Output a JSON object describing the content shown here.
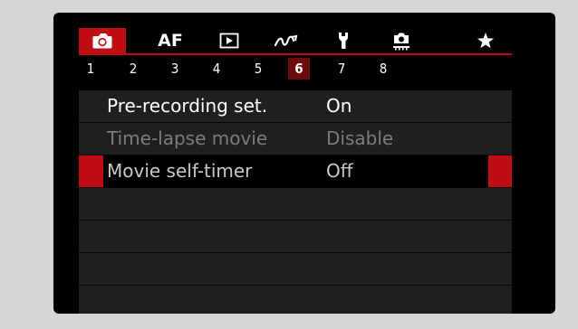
{
  "tabs": [
    {
      "icon": "camera-icon",
      "active": true
    },
    {
      "label": "AF"
    },
    {
      "icon": "playback-icon"
    },
    {
      "icon": "wireless-icon"
    },
    {
      "icon": "wrench-icon"
    },
    {
      "icon": "custom-functions-icon"
    },
    {
      "icon": "star-icon"
    }
  ],
  "tab_af_label": "AF",
  "subtabs": [
    "1",
    "2",
    "3",
    "4",
    "5",
    "6",
    "7",
    "8"
  ],
  "active_subtab": "6",
  "menu": [
    {
      "label": "Pre-recording set.",
      "value": "On",
      "state": "enabled"
    },
    {
      "label": "Time-lapse movie",
      "value": "Disable",
      "state": "disabled"
    },
    {
      "label": "Movie self-timer",
      "value": "Off",
      "state": "selected"
    }
  ],
  "colors": {
    "accent": "#c00d13",
    "active_subtab": "#6b0c0f",
    "row": "#1f1f1f",
    "disabled_text": "#7d7d7d"
  }
}
